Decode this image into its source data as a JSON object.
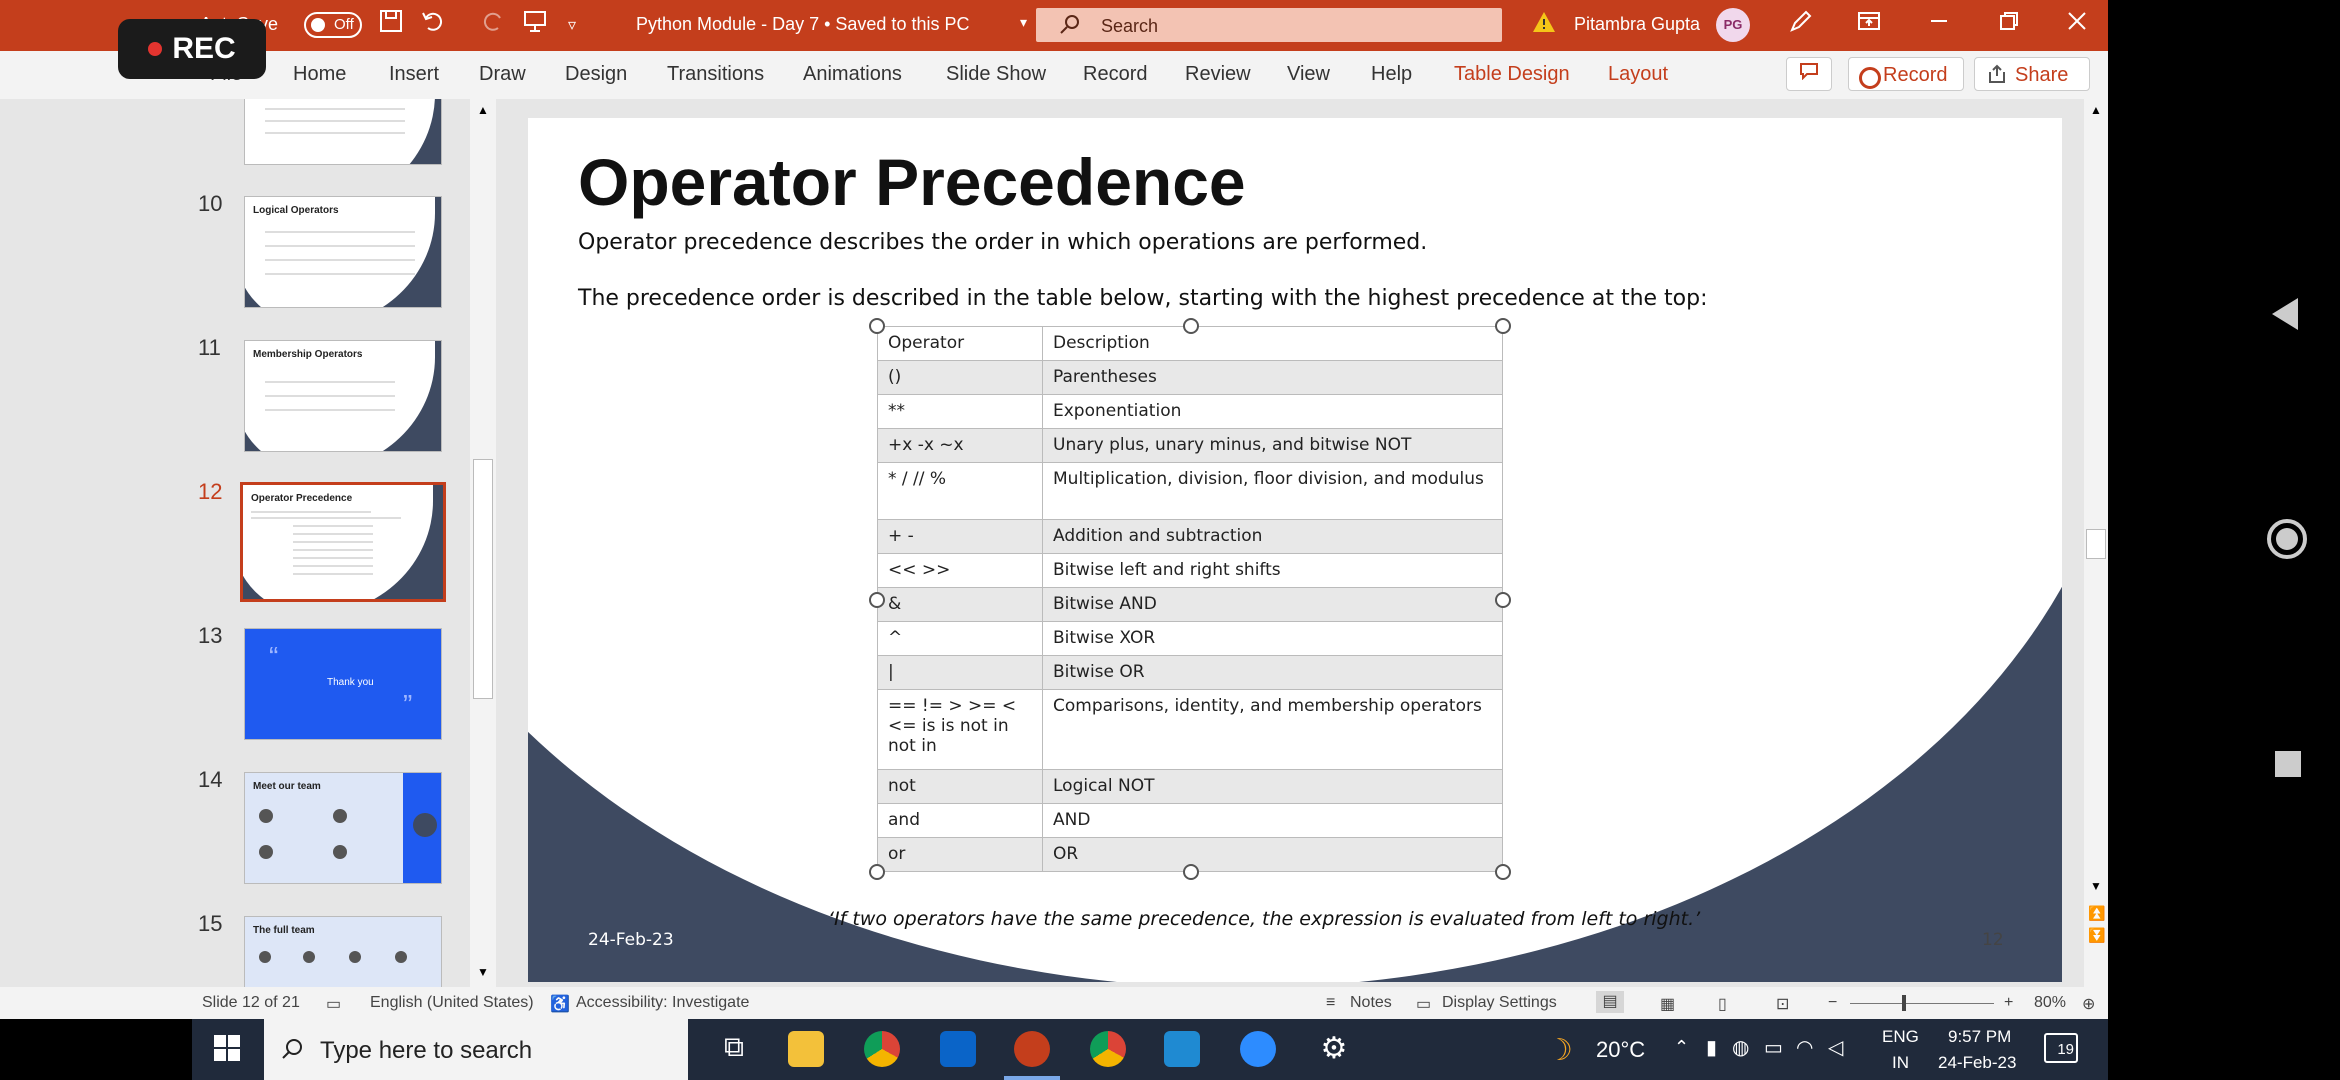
{
  "recorder": {
    "label": "REC"
  },
  "titlebar": {
    "autosave_label": "AutoSave",
    "autosave_state": "Off",
    "document_title": "Python Module - Day 7 • Saved to this PC",
    "search_placeholder": "Search",
    "user_name": "Pitambra Gupta",
    "user_initials": "PG"
  },
  "ribbon": {
    "tabs": [
      "File",
      "Home",
      "Insert",
      "Draw",
      "Design",
      "Transitions",
      "Animations",
      "Slide Show",
      "Record",
      "Review",
      "View",
      "Help",
      "Table Design",
      "Layout"
    ],
    "record_button": "Record",
    "share_button": "Share"
  },
  "thumbnails": [
    {
      "number": "",
      "title": ""
    },
    {
      "number": "10",
      "title": "Logical Operators"
    },
    {
      "number": "11",
      "title": "Membership Operators"
    },
    {
      "number": "12",
      "title": "Operator Precedence"
    },
    {
      "number": "13",
      "title": "Thank you"
    },
    {
      "number": "14",
      "title": "Meet our team"
    },
    {
      "number": "15",
      "title": "The full team"
    }
  ],
  "slide": {
    "title": "Operator Precedence",
    "line1": "Operator precedence describes the order in which operations are performed.",
    "line2": "The precedence order is described in the table below, starting with the highest precedence at the top:",
    "table_header": {
      "operator": "Operator",
      "description": "Description"
    },
    "rows": [
      {
        "op": "()",
        "desc": "Parentheses"
      },
      {
        "op": "**",
        "desc": "Exponentiation"
      },
      {
        "op": "+x  -x  ~x",
        "desc": "Unary plus, unary minus, and bitwise NOT"
      },
      {
        "op": "*  /  //  %",
        "desc": "Multiplication, division, floor division, and modulus"
      },
      {
        "op": "+  -",
        "desc": "Addition and subtraction"
      },
      {
        "op": "<<  >>",
        "desc": "Bitwise left and right shifts"
      },
      {
        "op": "&",
        "desc": "Bitwise AND"
      },
      {
        "op": "^",
        "desc": "Bitwise XOR"
      },
      {
        "op": "|",
        "desc": "Bitwise OR"
      },
      {
        "op": "==  !=  >  >=  <  <=  is  is not  in  not in",
        "desc": "Comparisons, identity, and membership operators"
      },
      {
        "op": "not",
        "desc": "Logical NOT"
      },
      {
        "op": "and",
        "desc": "AND"
      },
      {
        "op": "or",
        "desc": "OR"
      }
    ],
    "quote": "‘If two operators have the same precedence, the expression is evaluated from left to right.’",
    "footer_date": "24-Feb-23",
    "footer_page": "12"
  },
  "statusbar": {
    "slide_info": "Slide 12 of 21",
    "language": "English (United States)",
    "accessibility": "Accessibility: Investigate",
    "notes": "Notes",
    "display_settings": "Display Settings",
    "zoom": "80%"
  },
  "taskbar": {
    "search_placeholder": "Type here to search",
    "weather": "20°C",
    "lang_top": "ENG",
    "lang_bottom": "IN",
    "time": "9:57 PM",
    "date": "24-Feb-23",
    "notification_count": "19"
  }
}
